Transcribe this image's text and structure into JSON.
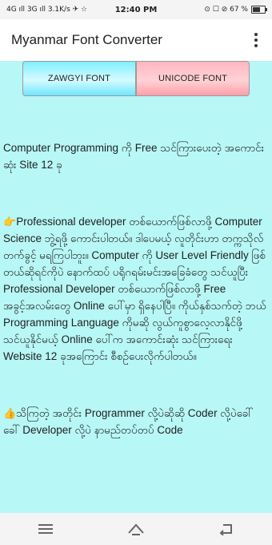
{
  "status_bar": {
    "left": "4G ıll 3G ıll 3.1K/s ✈ ☆",
    "time": "12:40 PM",
    "right": "⊙ ☐ ⊘ 67 %",
    "battery_level": 0.67
  },
  "app_bar": {
    "title": "Myanmar Font Converter",
    "menu_icon": "more-vertical-icon"
  },
  "tabs": [
    {
      "label": "ZAWGYI FONT",
      "color": "#7ff0ff"
    },
    {
      "label": "UNICODE FONT",
      "color": "#ffb7bf"
    }
  ],
  "content": {
    "background": "#b7f7f5",
    "paragraphs": [
      "Computer Programming ကို Free သင်ကြားပေးတဲ့ အကောင်းဆုံး Site 12 ခု",
      "Professional developer တစ်ယောက်ဖြစ်လာဖို့ Computer Science ဘွဲ့ရဖို့ ကောင်းပါတယ်။ ဒါပေမယ့် လူတိုင်းဟာ တက္ကသိုလ်တက်ခွင့် မရကြပါဘူး။ Computer ကို User Level Friendly ဖြစ်တယ်ဆိုရင်ကိုပဲ နောက်ထပ် ပရိုဂရမ်းမင်းအခြေခံတွေ သင်ယူပြီး Professional Developer တစ်ယောက်ဖြစ်လာဖို့ Free အခွင့်အလမ်းတွေ Online ပေါ်မှာ ရှိနေပါပြီ။ ကိုယ်နှစ်သက်တဲ့ ဘယ် Programming Language ကိုမဆို လွယ်ကူစွာလေ့လာနိုင်ဖို့ သင်ယူနိုင်မယ့် Online ပေါ်က အကောင်းဆုံး သင်ကြားရေး Website 12 ခုအကြောင်း စီစဉ်ပေးလိုက်ပါတယ်။",
      "သိကြတဲ့ အတိုင်း Programmer လို့ပဲဆိုဆို Coder လို့ပဲခေါ်ခေါ် Developer လို့ပဲ နာမည်တပ်တပ် Code"
    ],
    "paragraph_icons": [
      "",
      "pointing-hand-icon",
      "thumbs-up-icon"
    ]
  },
  "nav_bar": {
    "buttons": [
      "menu-icon",
      "home-icon",
      "back-icon"
    ]
  }
}
